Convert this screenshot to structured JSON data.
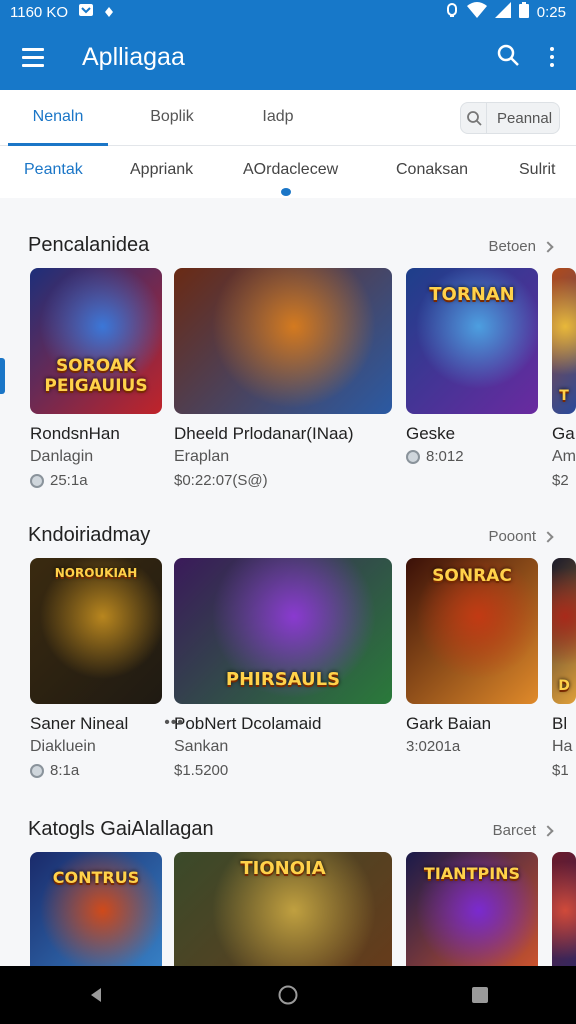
{
  "status": {
    "time_left": "1160 KO",
    "time_right": "0:25"
  },
  "app_bar": {
    "title": "Aplliagaa"
  },
  "top_tabs": [
    {
      "label": "Nenaln",
      "active": true
    },
    {
      "label": "Boplik",
      "active": false
    },
    {
      "label": "Iadp",
      "active": false
    }
  ],
  "search_chip": {
    "label": "Peannal"
  },
  "subnav": [
    {
      "label": "Peantak",
      "active": true
    },
    {
      "label": "Appriank",
      "active": false
    },
    {
      "label": "AOrdaclecew",
      "active": false
    },
    {
      "label": "Conaksan",
      "active": false
    },
    {
      "label": "Sulrit",
      "active": false
    }
  ],
  "sections": [
    {
      "title": "Pencalanidea",
      "more": "Betoen",
      "cards": [
        {
          "name": "RondsnHan",
          "sub": "Danlagin",
          "meta": "25:1a",
          "art_text": "SOROAK PEIGAUIUS",
          "art_colors": [
            "#1d2f7a",
            "#3b77d8",
            "#c0242a"
          ]
        },
        {
          "name": "Dheeld Prlodanar(INaa)",
          "sub": "Eraplan",
          "meta": "$0:22:07(S@)",
          "art_text": "",
          "art_colors": [
            "#6a2a14",
            "#d47a1f",
            "#2b5aa3"
          ]
        },
        {
          "name": "Geske",
          "sub": "",
          "meta": "8:012",
          "art_text": "TORNAN",
          "art_colors": [
            "#1d3f8a",
            "#4d9fe0",
            "#6a2aa0"
          ]
        },
        {
          "name": "Ga",
          "sub": "Am",
          "meta": "$2",
          "art_text": "T",
          "art_colors": [
            "#b04a1a",
            "#e8b83a",
            "#2a4a9a"
          ]
        }
      ]
    },
    {
      "title": "Kndoiriadmay",
      "more": "Pooont",
      "cards": [
        {
          "name": "Saner Nineal",
          "sub": "Diakluein",
          "meta": "8:1a",
          "art_text": "NOROUKIAH",
          "art_colors": [
            "#3a2a10",
            "#b8861f",
            "#1f1a12"
          ]
        },
        {
          "name": "PobNert Dcolamaid",
          "sub": "Sankan",
          "meta": "$1.5200",
          "art_text": "PHIRSAULS",
          "art_colors": [
            "#3a1a5a",
            "#8a3ad0",
            "#2a7a3a"
          ]
        },
        {
          "name": "Gark Baian",
          "sub": "",
          "meta": "3:0201a",
          "art_text": "SONRAC",
          "art_colors": [
            "#3a1008",
            "#c23a14",
            "#e08a2a"
          ]
        },
        {
          "name": "Bl",
          "sub": "Ha",
          "meta": "$1",
          "art_text": "D",
          "art_colors": [
            "#1a1a2a",
            "#a82a1a",
            "#e0a03a"
          ]
        }
      ]
    },
    {
      "title": "Katogls GaiAlallagan",
      "more": "Barcet",
      "cards": [
        {
          "name": "",
          "sub": "",
          "meta": "",
          "art_text": "CONTRUS",
          "art_colors": [
            "#1a2a6a",
            "#d04a1a",
            "#3a8ad0"
          ]
        },
        {
          "name": "",
          "sub": "",
          "meta": "",
          "art_text": "TIONOIA",
          "art_colors": [
            "#3a4a2a",
            "#c0a040",
            "#6a3a1a"
          ]
        },
        {
          "name": "",
          "sub": "",
          "meta": "",
          "art_text": "TIANTPINS",
          "art_colors": [
            "#1a1a4a",
            "#7a2ad0",
            "#e05a2a"
          ]
        },
        {
          "name": "",
          "sub": "",
          "meta": "",
          "art_text": "",
          "art_colors": [
            "#6a1a2a",
            "#d04a3a",
            "#2a2a6a"
          ]
        }
      ]
    }
  ]
}
